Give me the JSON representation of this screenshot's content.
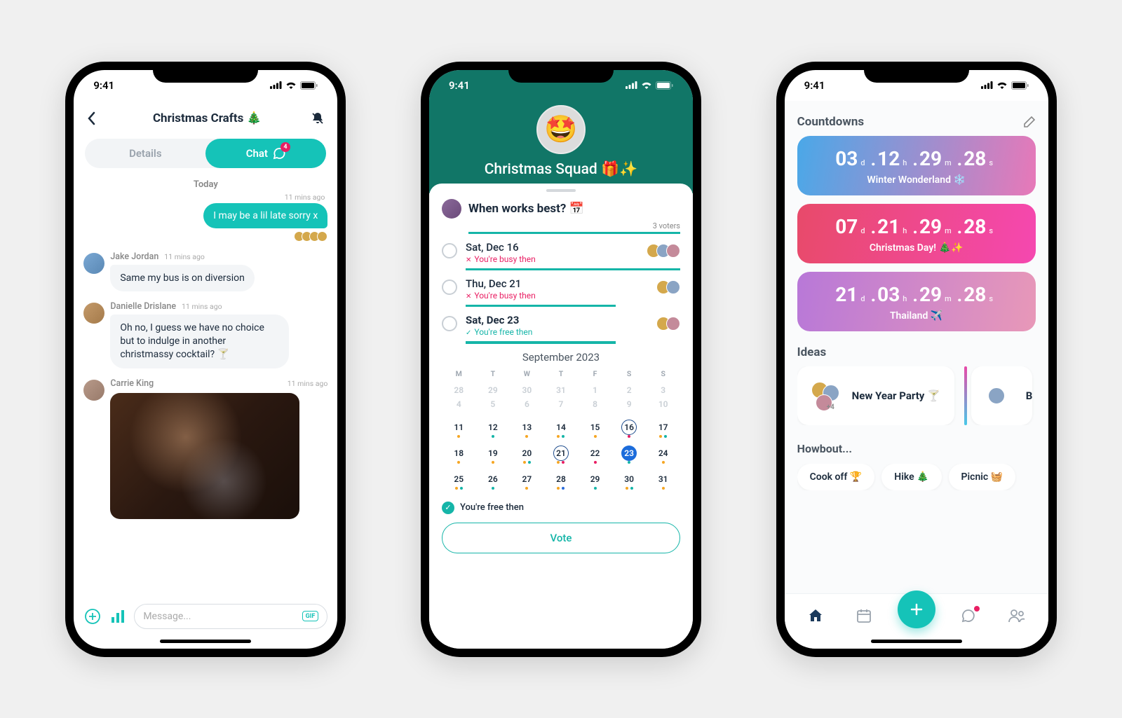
{
  "status": {
    "time": "9:41"
  },
  "phone1": {
    "title": "Christmas Crafts 🎄",
    "tabs": {
      "details": "Details",
      "chat": "Chat",
      "badge": "4"
    },
    "today": "Today",
    "out_time": "11 mins ago",
    "out_msg": "I may be a lil late sorry x",
    "msg1": {
      "name": "Jake Jordan",
      "time": "11 mins ago",
      "text": "Same my bus is on diversion"
    },
    "msg2": {
      "name": "Danielle Drislane",
      "time": "11 mins ago",
      "text": "Oh no, I guess we have no choice but to indulge in another christmassy cocktail? 🍸"
    },
    "msg3": {
      "name": "Carrie King",
      "time": "11 mins ago"
    },
    "composer": {
      "placeholder": "Message...",
      "gif": "GIF"
    }
  },
  "phone2": {
    "group": "Christmas Squad 🎁✨",
    "group_emoji": "🤩",
    "question": "When works best? 📅",
    "voters": "3 voters",
    "options": [
      {
        "title": "Sat, Dec 16",
        "sub": "You're busy then",
        "status": "busy"
      },
      {
        "title": "Thu, Dec 21",
        "sub": "You're busy then",
        "status": "busy"
      },
      {
        "title": "Sat, Dec 23",
        "sub": "You're free then",
        "status": "free",
        "bold": true
      }
    ],
    "cal_title": "September 2023",
    "cal_headers": [
      "M",
      "T",
      "W",
      "T",
      "F",
      "S",
      "S"
    ],
    "free_note": "You're free then",
    "vote": "Vote"
  },
  "phone3": {
    "countdowns_title": "Countdowns",
    "cds": [
      {
        "d": "03",
        "h": "12",
        "m": "29",
        "s": "28",
        "label": "Winter Wonderland ❄️"
      },
      {
        "d": "07",
        "h": "21",
        "m": "29",
        "s": "28",
        "label": "Christmas Day! 🎄✨"
      },
      {
        "d": "21",
        "h": "03",
        "m": "29",
        "s": "28",
        "label": "Thailand ✈️"
      }
    ],
    "units": {
      "d": "d",
      "h": "h",
      "m": "m",
      "s": "s"
    },
    "ideas_title": "Ideas",
    "idea1": {
      "title": "New Year Party 🍸",
      "more": "+4"
    },
    "idea2_peek": "B",
    "howbout_title": "Howbout...",
    "chips": [
      "Cook off 🏆",
      "Hike 🎄",
      "Picnic 🧺"
    ]
  }
}
